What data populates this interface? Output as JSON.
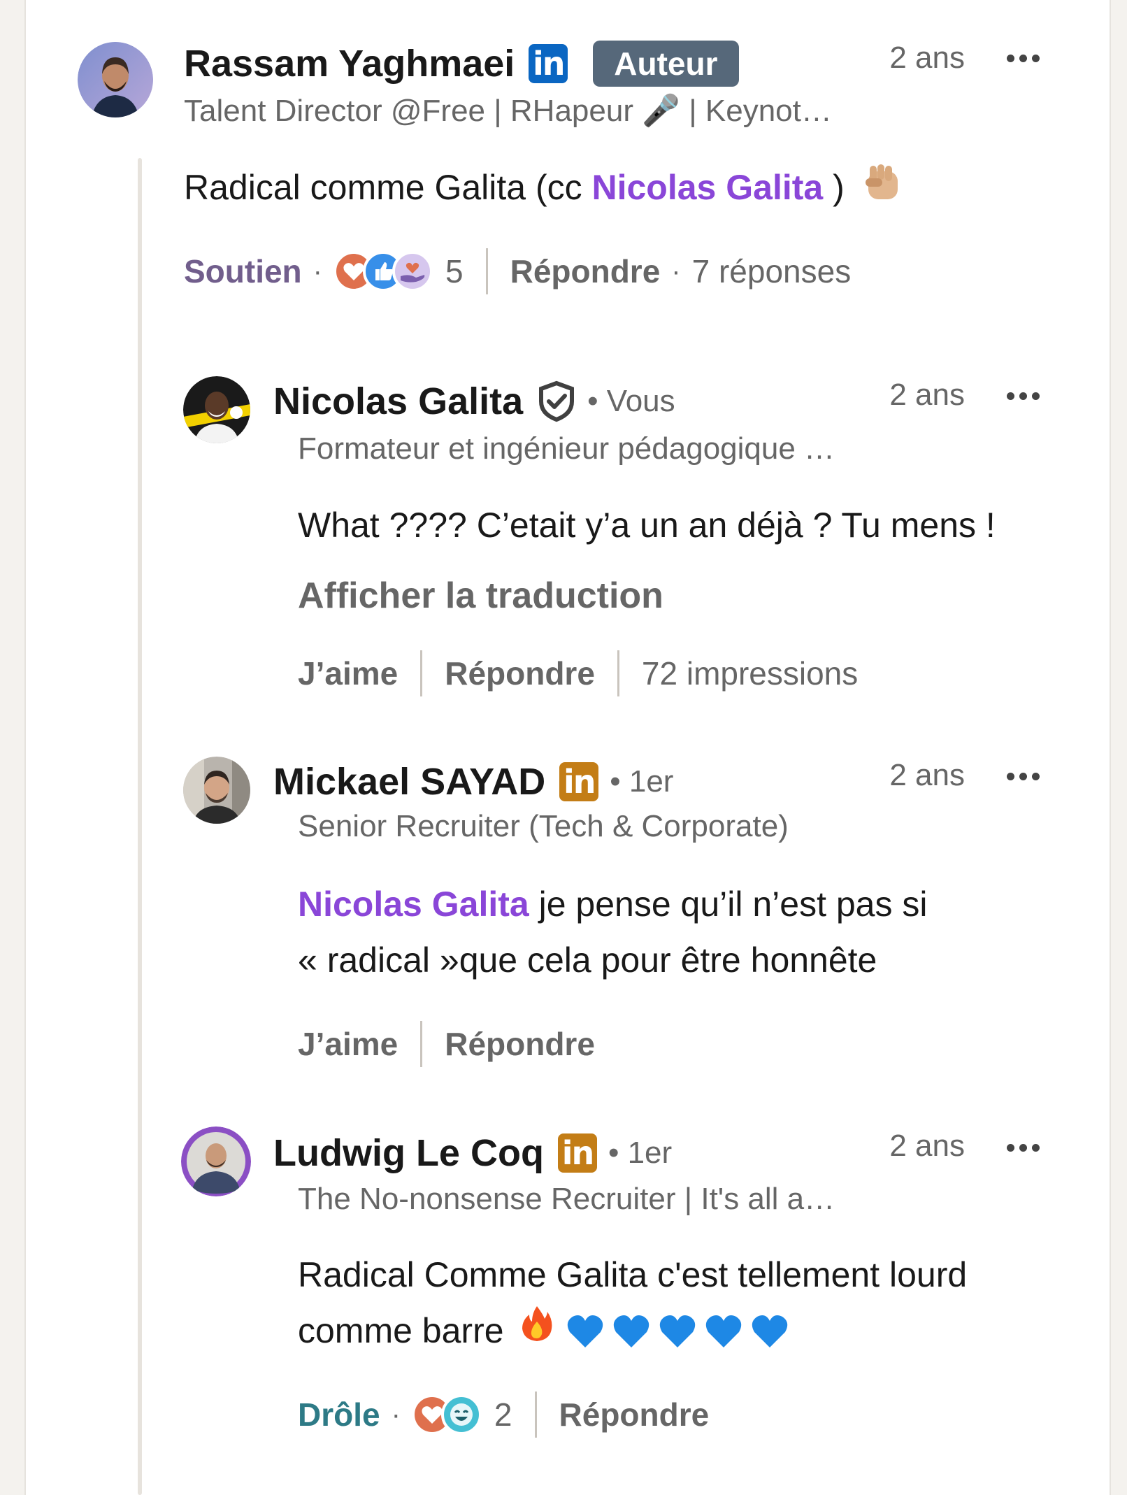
{
  "comments": [
    {
      "name": "Rassam Yaghmaei",
      "badge_text": "in",
      "author_badge": "Auteur",
      "headline": "Talent Director @Free | RHapeur 🎤 | Keynot…",
      "time": "2 ans",
      "text_before": "Radical comme Galita (cc ",
      "mention": "Nicolas Galita",
      "text_after": " )",
      "reaction_label": "Soutien",
      "reaction_count": "5",
      "reply_label": "Répondre",
      "replies_count": "7 réponses"
    },
    {
      "name": "Nicolas Galita",
      "degree": "• Vous",
      "headline": "Formateur et ingénieur pédagogique …",
      "time": "2 ans",
      "text": "What ???? C’etait y’a un an déjà ? Tu mens !",
      "translate": "Afficher la traduction",
      "like_label": "J’aime",
      "reply_label": "Répondre",
      "impressions": "72 impressions"
    },
    {
      "name": "Mickael SAYAD",
      "badge_text": "in",
      "degree": "• 1er",
      "headline": "Senior Recruiter (Tech & Corporate)",
      "time": "2 ans",
      "mention": "Nicolas Galita",
      "text_line1": " je pense qu’il n’est pas si",
      "text_line2": "« radical »que cela pour être honnête",
      "like_label": "J’aime",
      "reply_label": "Répondre"
    },
    {
      "name": "Ludwig Le Coq",
      "badge_text": "in",
      "degree": "• 1er",
      "headline": "The No-nonsense Recruiter | It's all a…",
      "time": "2 ans",
      "text_line1": "Radical Comme Galita c'est tellement lourd",
      "text_line2": "comme barre",
      "reaction_label": "Drôle",
      "reaction_count": "2",
      "reply_label": "Répondre"
    }
  ],
  "colors": {
    "mention": "#8a46d8",
    "linkedin_blue": "#0a66c2",
    "linkedin_gold": "#c37d16",
    "author_badge_bg": "#56687a",
    "soutien": "#715e8c",
    "drole": "#2d7a86"
  },
  "icons": [
    "linkedin-icon",
    "verified-shield-icon",
    "more-options-icon",
    "fist-emoji",
    "fire-emoji",
    "blue-heart-emoji",
    "mic-emoji"
  ]
}
